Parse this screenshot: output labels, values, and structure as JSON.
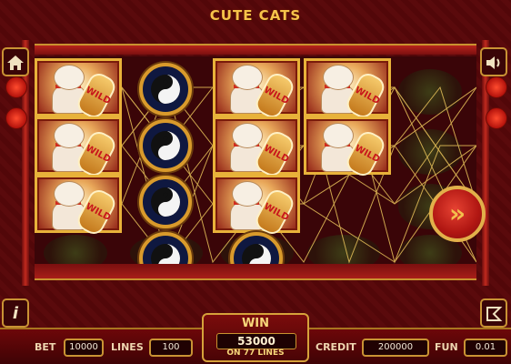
{
  "game": {
    "title": "CUTE CATS"
  },
  "reels": {
    "symbols": {
      "wild_label": "WILD"
    }
  },
  "controls": {
    "home_icon": "home-icon",
    "sound_icon": "speaker-icon",
    "info_icon": "info-icon",
    "autoplay_icon": "autoplay-icon",
    "spin_icon": "double-chevron-right-icon",
    "spin_glyph": "»"
  },
  "footer": {
    "bet_label": "BET",
    "bet_value": "10000",
    "lines_label": "LINES",
    "lines_value": "100",
    "win_label": "WIN",
    "win_value": "53000",
    "win_lines": "ON 77 LINES",
    "credit_label": "CREDIT",
    "credit_value": "200000",
    "fun_label": "FUN",
    "fun_value": "0.01"
  },
  "colors": {
    "gold": "#f7c34a",
    "panel_red": "#7a0f0f",
    "background": "#4a0608"
  }
}
